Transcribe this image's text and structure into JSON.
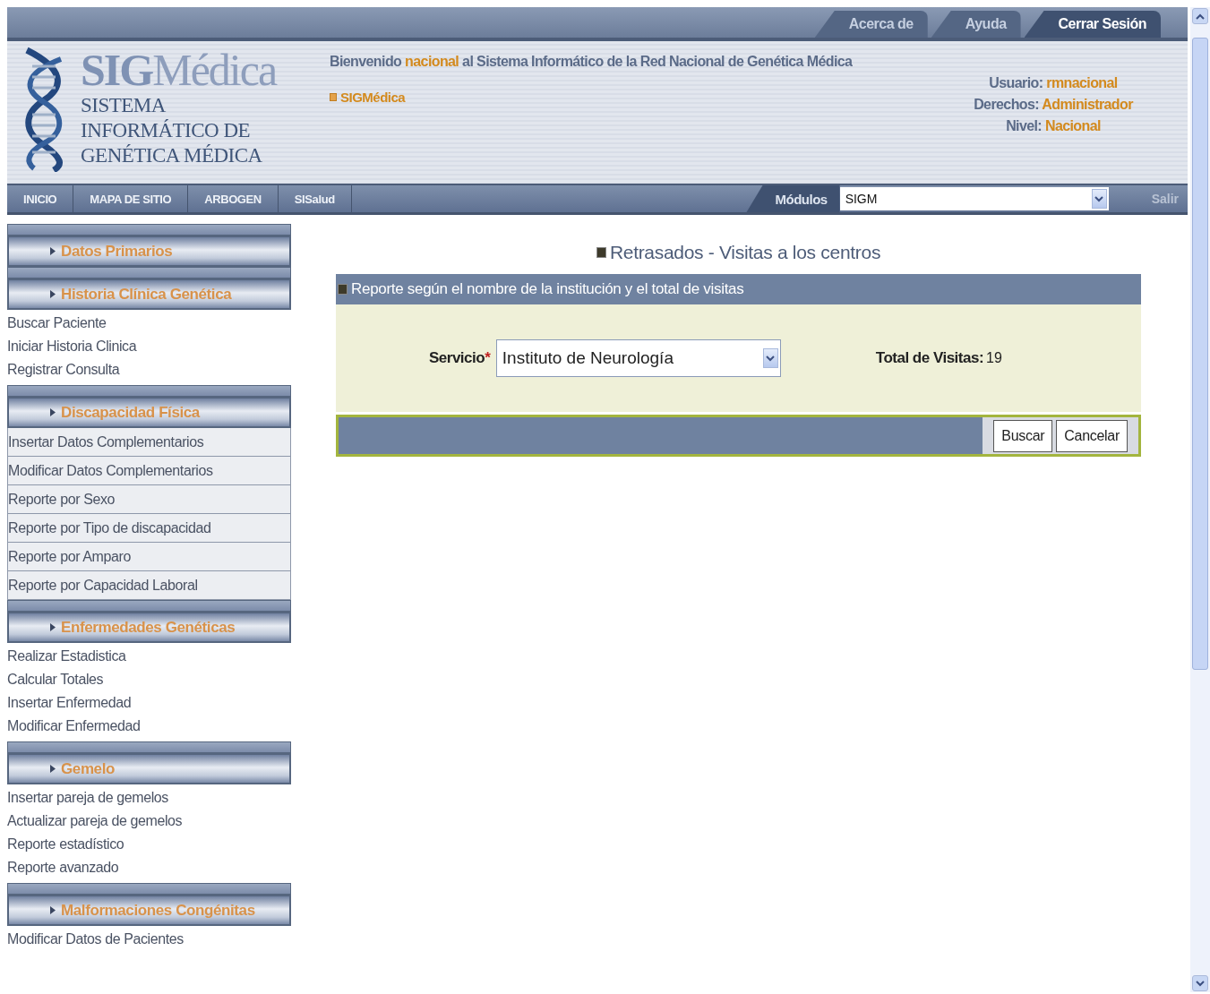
{
  "top_tabs": [
    {
      "label": "Acerca de",
      "selected": false
    },
    {
      "label": "Ayuda",
      "selected": false
    },
    {
      "label": "Cerrar Sesión",
      "selected": true
    }
  ],
  "header": {
    "logo_title_bold": "SIG",
    "logo_title_rest": "Médica",
    "logo_subtitle": [
      "SISTEMA",
      "INFORMÁTICO DE",
      "GENÉTICA MÉDICA"
    ],
    "welcome_prefix": "Bienvenido",
    "welcome_name": "nacional",
    "welcome_suffix": "al Sistema Informático de la Red Nacional de Genética Médica",
    "home_link": "SIGMédica",
    "user_info": [
      {
        "label": "Usuario:",
        "value": "rmnacional"
      },
      {
        "label": "Derechos:",
        "value": "Administrador"
      },
      {
        "label": "Nivel:",
        "value": "Nacional"
      }
    ]
  },
  "nav": {
    "items": [
      "INICIO",
      "MAPA DE SITIO",
      "ARBOGEN",
      "SISalud"
    ],
    "modules_label": "Módulos",
    "modules_value": "SIGM",
    "exit": {
      "label": "Salir",
      "disabled": true
    }
  },
  "sidebar": [
    {
      "title": "Datos Primarios"
    },
    {
      "title": "Historia Clínica Genética",
      "kind": "plain",
      "items": [
        "Buscar Paciente",
        "Iniciar Historia Clinica",
        "Registrar Consulta"
      ]
    },
    {
      "title": "Discapacidad Física",
      "kind": "boxed",
      "items": [
        "Insertar Datos Complementarios",
        "Modificar Datos Complementarios",
        "Reporte por Sexo",
        "Reporte por Tipo de discapacidad",
        "Reporte por Amparo",
        "Reporte por Capacidad Laboral"
      ]
    },
    {
      "title": "Enfermedades Genéticas",
      "kind": "plain",
      "items": [
        "Realizar Estadistica",
        "Calcular Totales",
        "Insertar Enfermedad",
        "Modificar Enfermedad"
      ]
    },
    {
      "title": "Gemelo",
      "kind": "plain",
      "items": [
        "Insertar pareja de gemelos",
        "Actualizar pareja de gemelos",
        "Reporte estadístico",
        "Reporte avanzado"
      ]
    },
    {
      "title": "Malformaciones Congénitas",
      "kind": "plain",
      "items": [
        "Modificar Datos de Pacientes"
      ]
    }
  ],
  "content": {
    "title": "Retrasados - Visitas a los centros",
    "panel_title": "Reporte según el nombre de la institución y el total de visitas",
    "field_label": "Servicio",
    "required_mark": "*",
    "field_value": "Instituto de Neurología",
    "total_label": "Total de Visitas:",
    "total_value": "19",
    "buttons": [
      "Buscar",
      "Cancelar"
    ]
  }
}
